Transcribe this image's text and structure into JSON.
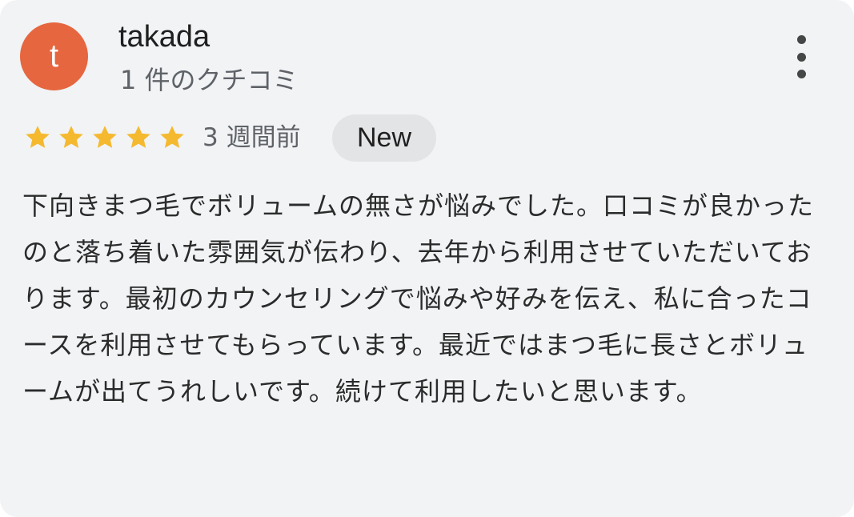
{
  "review": {
    "avatar_initial": "t",
    "reviewer_name": "takada",
    "review_count": "1 件のクチコミ",
    "rating": 5,
    "rating_max": 5,
    "time_ago": "3 週間前",
    "badge": "New",
    "text": "下向きまつ毛でボリュームの無さが悩みでした。口コミが良かったのと落ち着いた雰囲気が伝わり、去年から利用させていただいております。最初のカウンセリングで悩みや好みを伝え、私に合ったコースを利用させてもらっています。最近ではまつ毛に長さとボリュームが出てうれしいです。続けて利用したいと思います。"
  },
  "icons": {
    "more": "more-vert-icon",
    "star": "star-icon"
  },
  "colors": {
    "avatar_bg": "#e6663f",
    "star": "#f5b92f",
    "card_bg": "#f1f3f5",
    "badge_bg": "#e3e4e6"
  }
}
